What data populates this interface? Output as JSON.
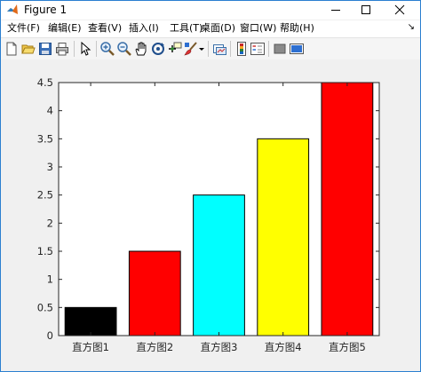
{
  "window": {
    "title": "Figure 1",
    "icon": "matlab-logo-icon",
    "controls": [
      "minimize-icon",
      "maximize-icon",
      "close-icon"
    ]
  },
  "menu": {
    "items": [
      "文件(F)",
      "编辑(E)",
      "查看(V)",
      "插入(I)",
      "工具(T)",
      "桌面(D)",
      "窗口(W)",
      "帮助(H)"
    ],
    "overflow_glyph": "↘"
  },
  "toolbar": {
    "icons": [
      "new-figure-icon",
      "open-file-icon",
      "save-icon",
      "print-icon",
      "edit-plot-arrow-icon",
      "zoom-in-icon",
      "zoom-out-icon",
      "pan-hand-icon",
      "rotate-3d-icon",
      "data-cursor-icon",
      "brush-icon",
      "brush-dropdown-icon",
      "link-plot-icon",
      "insert-colorbar-icon",
      "insert-legend-icon",
      "hide-plot-tools-icon",
      "show-plot-tools-icon"
    ]
  },
  "chart_data": {
    "type": "bar",
    "categories": [
      "直方图1",
      "直方图2",
      "直方图3",
      "直方图4",
      "直方图5"
    ],
    "values": [
      0.5,
      1.5,
      2.5,
      3.5,
      4.5
    ],
    "colors": [
      "#000000",
      "#ff0000",
      "#00ffff",
      "#ffff00",
      "#ff0000"
    ],
    "ylim": [
      0,
      4.5
    ],
    "yticks": [
      "0",
      "0.5",
      "1",
      "1.5",
      "2",
      "2.5",
      "3",
      "3.5",
      "4",
      "4.5"
    ],
    "title": "",
    "xlabel": "",
    "ylabel": "",
    "grid": false
  }
}
